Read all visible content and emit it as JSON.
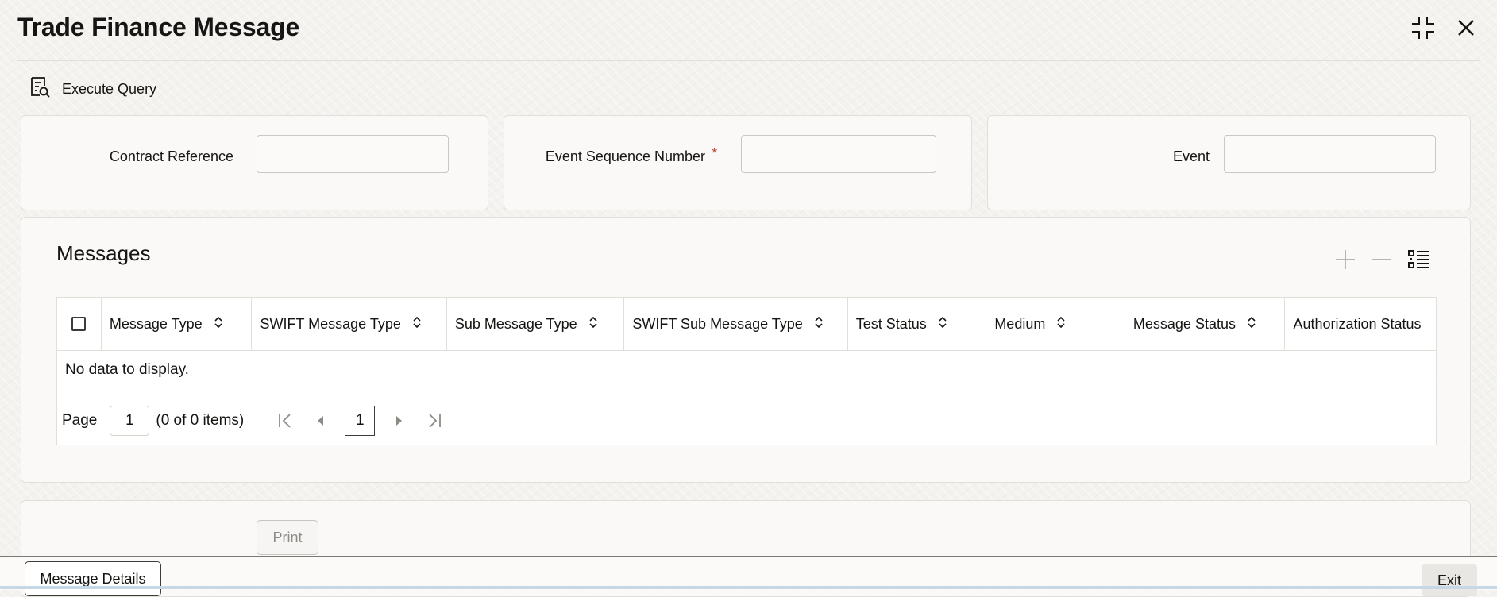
{
  "window": {
    "title": "Trade Finance Message",
    "icons": [
      "collapse-icon",
      "close-icon"
    ]
  },
  "toolbar": {
    "execute_query_label": "Execute Query",
    "icon": "query-document-icon"
  },
  "fields": {
    "contract_reference": {
      "label": "Contract Reference",
      "value": ""
    },
    "event_sequence_number": {
      "label": "Event Sequence Number",
      "required_mark": "*",
      "value": ""
    },
    "event": {
      "label": "Event",
      "value": ""
    }
  },
  "messages": {
    "title": "Messages",
    "tools": [
      "add-row-icon",
      "delete-row-icon",
      "column-list-icon"
    ],
    "columns": [
      {
        "label": "Message Type",
        "sortable": true
      },
      {
        "label": "SWIFT Message Type",
        "sortable": true
      },
      {
        "label": "Sub Message Type",
        "sortable": true
      },
      {
        "label": "SWIFT Sub Message Type",
        "sortable": true
      },
      {
        "label": "Test Status",
        "sortable": true
      },
      {
        "label": "Medium",
        "sortable": true
      },
      {
        "label": "Message Status",
        "sortable": true
      },
      {
        "label": "Authorization Status",
        "sortable": false
      }
    ],
    "empty_text": "No data to display.",
    "pager": {
      "page_label": "Page",
      "page_value": "1",
      "count_text": "(0 of 0 items)",
      "current_page": "1"
    }
  },
  "actions": {
    "print_label": "Print",
    "message_details_label": "Message Details",
    "exit_label": "Exit"
  }
}
